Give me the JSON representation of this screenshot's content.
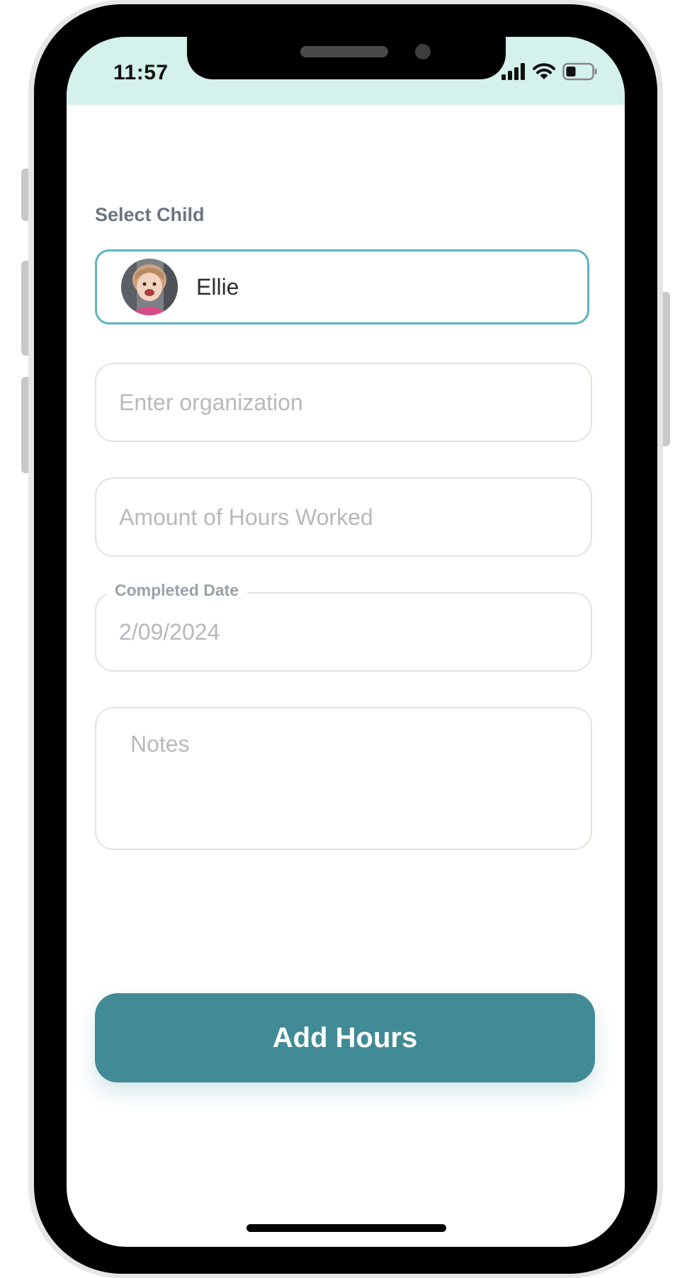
{
  "status_bar": {
    "time": "11:57",
    "icons": [
      "signal-icon",
      "wifi-icon",
      "battery-icon"
    ],
    "background": "#d4f1ec"
  },
  "form": {
    "select_child_label": "Select Child",
    "selected_child": {
      "name": "Ellie",
      "avatar": "child-avatar-photo"
    },
    "organization": {
      "value": "",
      "placeholder": "Enter organization"
    },
    "hours": {
      "value": "",
      "placeholder": "Amount of Hours Worked"
    },
    "completed_date": {
      "label": "Completed Date",
      "value": "2/09/2024"
    },
    "notes": {
      "value": "",
      "placeholder": "Notes"
    },
    "submit_label": "Add Hours"
  },
  "colors": {
    "accent": "#408b96",
    "select_border": "#5fb3c0",
    "placeholder": "#b8b8bd"
  }
}
